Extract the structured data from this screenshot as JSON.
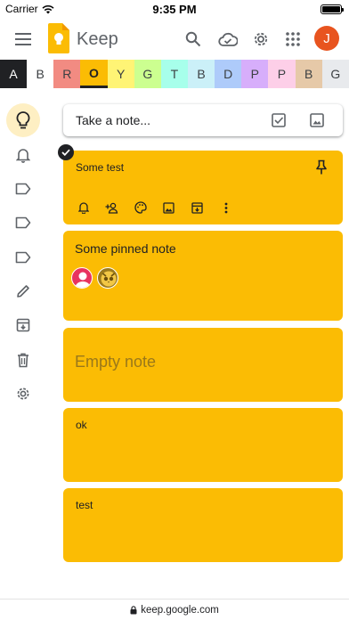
{
  "status_bar": {
    "carrier": "Carrier",
    "time": "9:35 PM"
  },
  "app_bar": {
    "app_name": "Keep",
    "avatar_initial": "J",
    "avatar_color": "#e8541f"
  },
  "color_filters": [
    {
      "letter": "A",
      "color": "#202124",
      "text_color": "#ffffff",
      "selected": false
    },
    {
      "letter": "B",
      "color": "#ffffff",
      "text_color": "#3c4043",
      "selected": false
    },
    {
      "letter": "R",
      "color": "#f28b82",
      "text_color": "#3c4043",
      "selected": false
    },
    {
      "letter": "O",
      "color": "#fbbc04",
      "text_color": "#202124",
      "selected": true
    },
    {
      "letter": "Y",
      "color": "#fff475",
      "text_color": "#3c4043",
      "selected": false
    },
    {
      "letter": "G",
      "color": "#ccff90",
      "text_color": "#3c4043",
      "selected": false
    },
    {
      "letter": "T",
      "color": "#a7ffeb",
      "text_color": "#3c4043",
      "selected": false
    },
    {
      "letter": "B",
      "color": "#cbf0f8",
      "text_color": "#3c4043",
      "selected": false
    },
    {
      "letter": "D",
      "color": "#aecbfa",
      "text_color": "#3c4043",
      "selected": false
    },
    {
      "letter": "P",
      "color": "#d7aefb",
      "text_color": "#3c4043",
      "selected": false
    },
    {
      "letter": "P",
      "color": "#fdcfe8",
      "text_color": "#3c4043",
      "selected": false
    },
    {
      "letter": "B",
      "color": "#e6c9a8",
      "text_color": "#3c4043",
      "selected": false
    },
    {
      "letter": "G",
      "color": "#e8eaed",
      "text_color": "#3c4043",
      "selected": false
    }
  ],
  "sidebar": {
    "items": [
      {
        "icon": "lightbulb-icon",
        "active": true
      },
      {
        "icon": "bell-icon",
        "active": false
      },
      {
        "icon": "label-icon",
        "active": false
      },
      {
        "icon": "label-icon",
        "active": false
      },
      {
        "icon": "label-icon",
        "active": false
      },
      {
        "icon": "pencil-icon",
        "active": false
      },
      {
        "icon": "archive-icon",
        "active": false
      },
      {
        "icon": "trash-icon",
        "active": false
      },
      {
        "icon": "gear-icon",
        "active": false
      }
    ]
  },
  "take_note": {
    "placeholder": "Take a note..."
  },
  "notes": [
    {
      "title": "Some test",
      "selected": true,
      "pinned": true
    },
    {
      "title": "Some pinned note",
      "collaborators": 2
    },
    {
      "title": "Empty note",
      "empty": true
    },
    {
      "title": "ok"
    },
    {
      "title": "test"
    }
  ],
  "note_color": "#fbbc04",
  "url_bar": {
    "url": "keep.google.com"
  }
}
